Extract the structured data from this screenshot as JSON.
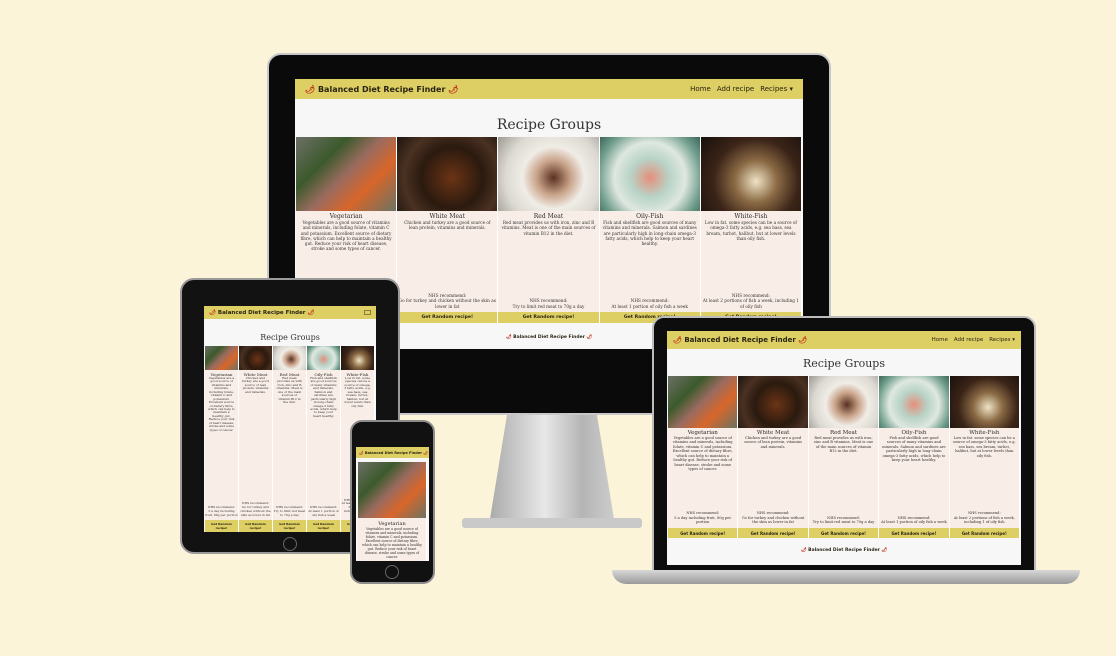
{
  "site": {
    "brand": "Balanced Diet Recipe Finder"
  },
  "nav": {
    "home": "Home",
    "add_recipe": "Add recipe",
    "recipes": "Recipes",
    "caret": "▾",
    "chili": "🌶"
  },
  "page": {
    "title": "Recipe Groups"
  },
  "footer": {
    "text": "Balanced Diet Recipe Finder"
  },
  "groups": [
    {
      "name": "Vegetarian",
      "desc": "Vegetables are a good source of vitamins and minerals, including folate, vitamin C and potassium. Excellent source of dietary fibre, which can help to maintain a healthy gut. Reduce your risk of heart disease, stroke and some types of cancer.",
      "nhs_label": "NHS recommend:",
      "nhs": "5 a day including fruit, 80g per portion",
      "button": "Get Random recipe!"
    },
    {
      "name": "White Meat",
      "desc": "Chicken and turkey are a good source of lean protein, vitamins and minerals.",
      "nhs_label": "NHS recommend:",
      "nhs": "Go for turkey and chicken without the skin as lower in fat",
      "button": "Get Random recipe!"
    },
    {
      "name": "Red Meat",
      "desc": "Red meat provides us with iron, zinc and B vitamins. Meat is one of the main sources of vitamin B12 in the diet.",
      "nhs_label": "NHS recommend:",
      "nhs": "Try to limit red meat to 70g a day",
      "button": "Get Random recipe!"
    },
    {
      "name": "Oily-Fish",
      "desc": "Fish and shellfish are good sources of many vitamins and minerals. Salmon and sardines are particularly high in long-chain omega-3 fatty acids, which help to keep your heart healthy.",
      "nhs_label": "NHS recommend:",
      "nhs": "At least 1 portion of oily fish a week",
      "button": "Get Random recipe!"
    },
    {
      "name": "White-Fish",
      "desc": "Low in fat. some species can be a source of omega-3 fatty acids, e.g. sea bass, sea bream, turbot, halibut, but at lower levels than oily fish.",
      "nhs_label": "NHS recommend:",
      "nhs": "At least 2 portions of fish a week, including 1 of oily fish",
      "button": "Get Random recipe!"
    }
  ],
  "colors": {
    "background": "#fbf4d9",
    "navbar": "#ddcf63",
    "card": "#f9ede7",
    "chili": "#c1331d"
  },
  "icons": [
    "chili-pepper-icon",
    "hamburger-menu-icon",
    "caret-down-icon"
  ]
}
